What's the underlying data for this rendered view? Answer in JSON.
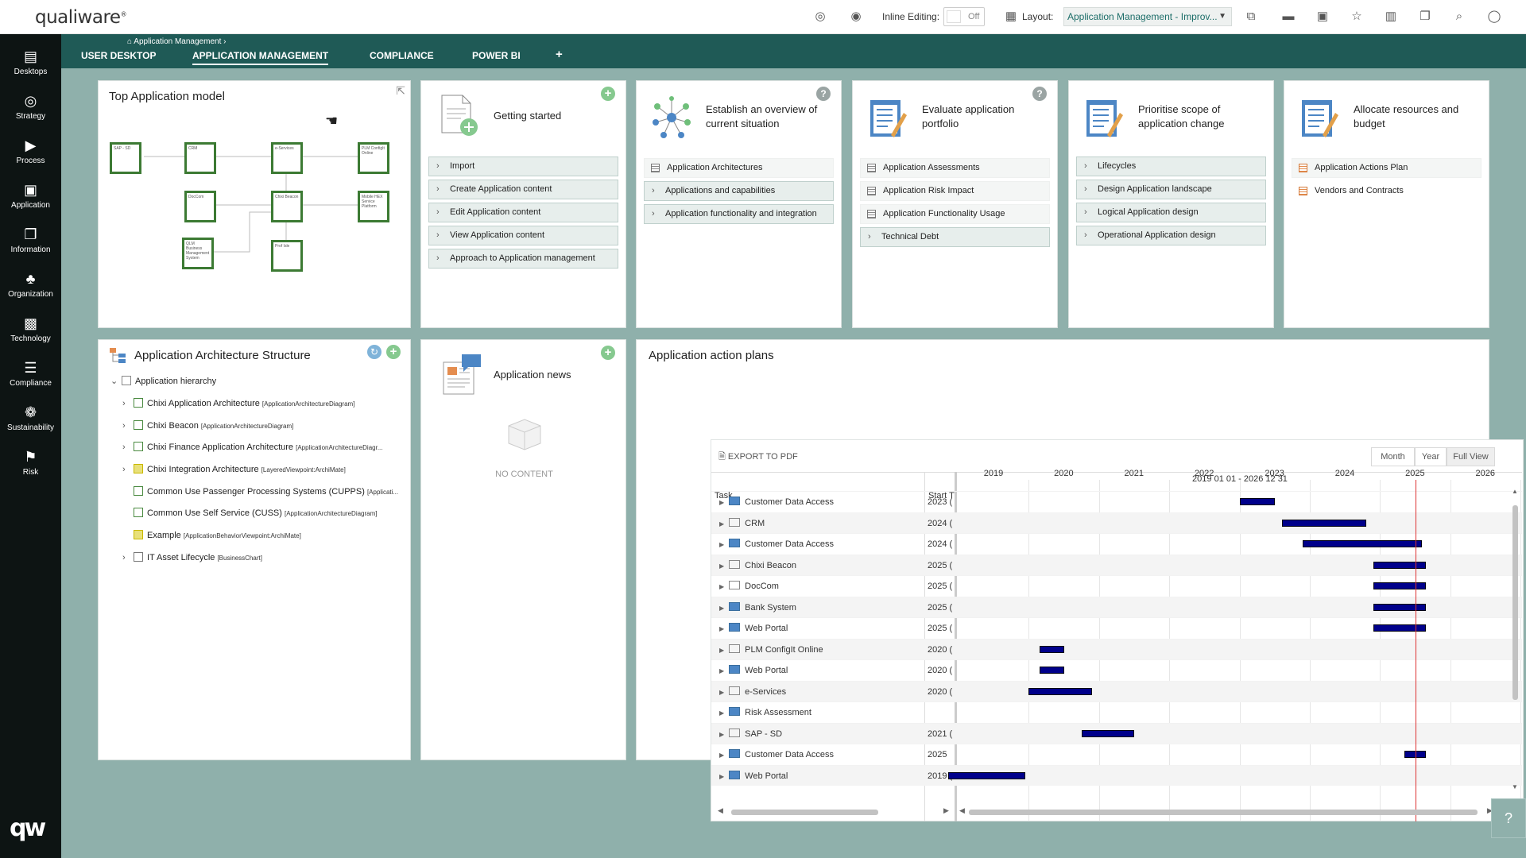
{
  "app": {
    "logo": "qualiware"
  },
  "topbar": {
    "inline_editing_label": "Inline Editing:",
    "inline_editing_value": "Off",
    "layout_label": "Layout:",
    "layout_value": "Application Management - Improv..."
  },
  "sidebar": {
    "items": [
      {
        "label": "Desktops",
        "icon": "desktops-icon"
      },
      {
        "label": "Strategy",
        "icon": "strategy-icon"
      },
      {
        "label": "Process",
        "icon": "process-icon"
      },
      {
        "label": "Application",
        "icon": "application-icon"
      },
      {
        "label": "Information",
        "icon": "information-icon"
      },
      {
        "label": "Organization",
        "icon": "organization-icon"
      },
      {
        "label": "Technology",
        "icon": "technology-icon"
      },
      {
        "label": "Compliance",
        "icon": "compliance-icon"
      },
      {
        "label": "Sustainability",
        "icon": "sustainability-icon"
      },
      {
        "label": "Risk",
        "icon": "risk-icon"
      }
    ],
    "bottom_logo": "qw"
  },
  "tabs": {
    "breadcrumb": "Application Management",
    "items": [
      "USER DESKTOP",
      "APPLICATION MANAGEMENT",
      "COMPLIANCE",
      "POWER BI",
      "+"
    ],
    "active": "APPLICATION MANAGEMENT"
  },
  "top_model": {
    "title": "Top Application model",
    "boxes": [
      "SAP - SD",
      "CRM",
      "e-Services",
      "PLM ConfigIt Online",
      "DocCom",
      "Chixi Beacon",
      "Mobile HEX Service Platform",
      "QLM Business Management System",
      "Prof Isle"
    ]
  },
  "getting_started": {
    "title": "Getting started",
    "items": [
      "Import",
      "Create Application content",
      "Edit Application content",
      "View Application content",
      "Approach to Application management"
    ]
  },
  "overview": {
    "title_line1": "Establish an overview of",
    "title_line2": "current situation",
    "items": [
      "Application Architectures",
      "Applications and capabilities",
      "Application functionality and integration"
    ]
  },
  "evaluate": {
    "title_line1": "Evaluate application",
    "title_line2": "portfolio",
    "items": [
      "Application Assessments",
      "Application Risk Impact",
      "Application Functionality Usage",
      "Technical Debt"
    ]
  },
  "prioritise": {
    "title_line1": "Prioritise scope of",
    "title_line2": "application change",
    "items": [
      "Lifecycles",
      "Design Application landscape",
      "Logical Application design",
      "Operational Application design"
    ]
  },
  "allocate": {
    "title_line1": "Allocate resources and",
    "title_line2": "budget",
    "items": [
      "Application Actions Plan",
      "Vendors and Contracts"
    ]
  },
  "structure": {
    "title": "Application Architecture Structure",
    "root": "Application hierarchy",
    "rows": [
      {
        "name": "Chixi Application Architecture",
        "tag": "[ApplicationArchitectureDiagram]"
      },
      {
        "name": "Chixi Beacon",
        "tag": "[ApplicationArchitectureDiagram]"
      },
      {
        "name": "Chixi Finance Application Architecture",
        "tag": "[ApplicationArchitectureDiagr..."
      },
      {
        "name": "Chixi Integration Architecture",
        "tag": "[LayeredViewpoint:ArchiMate]"
      },
      {
        "name": "Common Use Passenger Processing Systems (CUPPS)",
        "tag": "[Applicati..."
      },
      {
        "name": "Common Use Self Service (CUSS)",
        "tag": "[ApplicationArchitectureDiagram]"
      },
      {
        "name": "Example",
        "tag": "[ApplicationBehaviorViewpoint:ArchiMate]"
      },
      {
        "name": "IT Asset Lifecycle",
        "tag": "[BusinessChart]"
      }
    ]
  },
  "news": {
    "title": "Application news",
    "empty": "NO CONTENT"
  },
  "action_plans": {
    "title": "Application action plans",
    "export_label": "EXPORT TO PDF",
    "views": [
      "Month",
      "Year",
      "Full View"
    ],
    "active_view": "Full View",
    "range_label": "2019 01 01 - 2026 12 31",
    "col_task": "Task",
    "col_start": "Start T",
    "years": [
      "2019",
      "2020",
      "2021",
      "2022",
      "2023",
      "2024",
      "2025",
      "2026"
    ],
    "today_year": 2025.5,
    "rows": [
      {
        "task": "Customer Data Access",
        "start": "2023 (",
        "app": true,
        "bar": [
          2023.0,
          2023.5
        ]
      },
      {
        "task": "CRM",
        "start": "2024 (",
        "app": false,
        "bar": [
          2023.6,
          2024.8
        ]
      },
      {
        "task": "Customer Data Access",
        "start": "2024 (",
        "app": true,
        "bar": [
          2023.9,
          2025.6
        ]
      },
      {
        "task": "Chixi Beacon",
        "start": "2025 (",
        "app": false,
        "bar": [
          2024.9,
          2025.65
        ]
      },
      {
        "task": "DocCom",
        "start": "2025 (",
        "app": false,
        "bar": [
          2024.9,
          2025.65
        ]
      },
      {
        "task": "Bank System",
        "start": "2025 (",
        "app": true,
        "bar": [
          2024.9,
          2025.65
        ]
      },
      {
        "task": "Web Portal",
        "start": "2025 (",
        "app": true,
        "bar": [
          2024.9,
          2025.65
        ]
      },
      {
        "task": "PLM ConfigIt Online",
        "start": "2020 (",
        "app": false,
        "bar": [
          2020.15,
          2020.5
        ]
      },
      {
        "task": "Web Portal",
        "start": "2020 (",
        "app": true,
        "bar": [
          2020.15,
          2020.5
        ]
      },
      {
        "task": "e-Services",
        "start": "2020 (",
        "app": false,
        "bar": [
          2020.0,
          2020.9
        ]
      },
      {
        "task": "Risk Assessment",
        "start": "",
        "app": true,
        "bar": null
      },
      {
        "task": "SAP - SD",
        "start": "2021 (",
        "app": false,
        "bar": [
          2020.75,
          2021.5
        ]
      },
      {
        "task": "Customer Data Access",
        "start": "2025",
        "app": true,
        "bar": [
          2025.35,
          2025.65
        ]
      },
      {
        "task": "Web Portal",
        "start": "2019 (",
        "app": true,
        "bar": [
          2018.85,
          2019.95
        ]
      }
    ]
  }
}
